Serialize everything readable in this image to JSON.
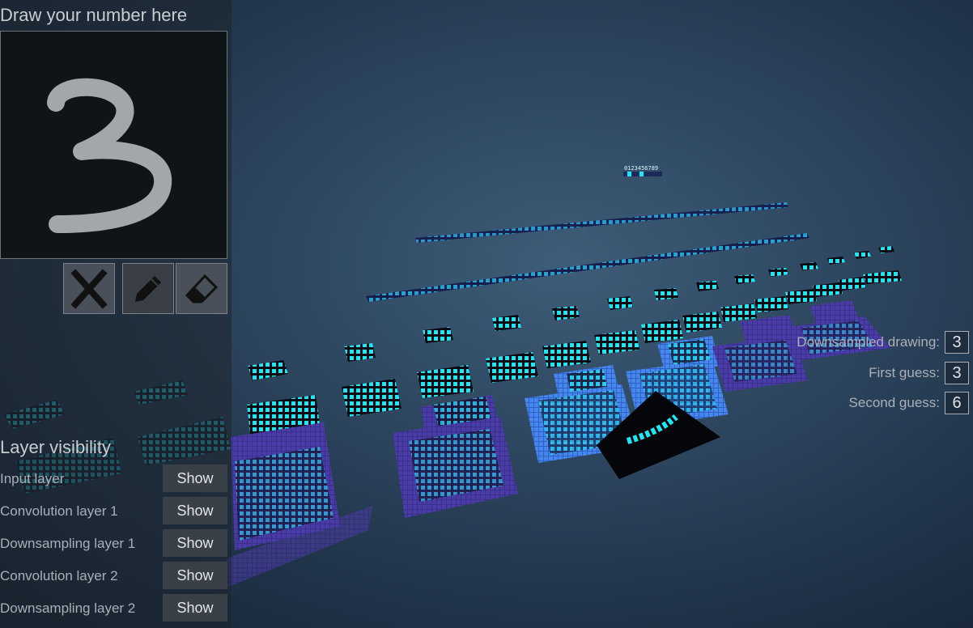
{
  "draw_panel": {
    "title": "Draw your number here"
  },
  "tools": {
    "clear_icon": "x-icon",
    "pencil_icon": "pencil-icon",
    "eraser_icon": "eraser-icon"
  },
  "results": {
    "downsampled_label": "Downsampled drawing:",
    "downsampled_value": "3",
    "first_guess_label": "First guess:",
    "first_guess_value": "3",
    "second_guess_label": "Second guess:",
    "second_guess_value": "6"
  },
  "layer_visibility": {
    "title": "Layer visibility",
    "show_label": "Show",
    "layers": [
      {
        "label": "Input layer"
      },
      {
        "label": "Convolution layer 1"
      },
      {
        "label": "Downsampling layer 1"
      },
      {
        "label": "Convolution layer 2"
      },
      {
        "label": "Downsampling layer 2"
      }
    ]
  },
  "output_digits": "0123456789",
  "colors": {
    "cyan": "#1fe8f5",
    "blue": "#3f7fe6",
    "purple": "#4a3aa8",
    "stroke": "#a3a7ab"
  }
}
